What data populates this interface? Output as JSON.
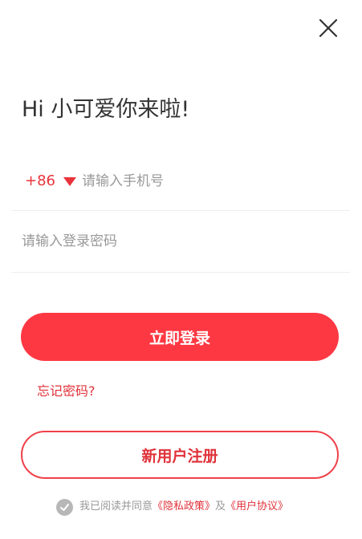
{
  "colors": {
    "accent": "#fd3843",
    "accent_text": "#e0323a",
    "placeholder": "#999999",
    "divider": "#eeeeee",
    "check_gray": "#b7b7b7"
  },
  "header": {
    "close_icon": "close-icon"
  },
  "greeting": "Hi 小可爱你来啦!",
  "phone": {
    "country_code": "+86",
    "placeholder": "请输入手机号",
    "value": ""
  },
  "password": {
    "placeholder": "请输入登录密码",
    "value": ""
  },
  "login_label": "立即登录",
  "forgot_label": "忘记密码?",
  "register_label": "新用户注册",
  "agreement": {
    "checked": true,
    "prefix": "我已阅读并同意",
    "privacy_link": "《隐私政策》",
    "conjunction": "及",
    "terms_link": "《用户协议》"
  }
}
